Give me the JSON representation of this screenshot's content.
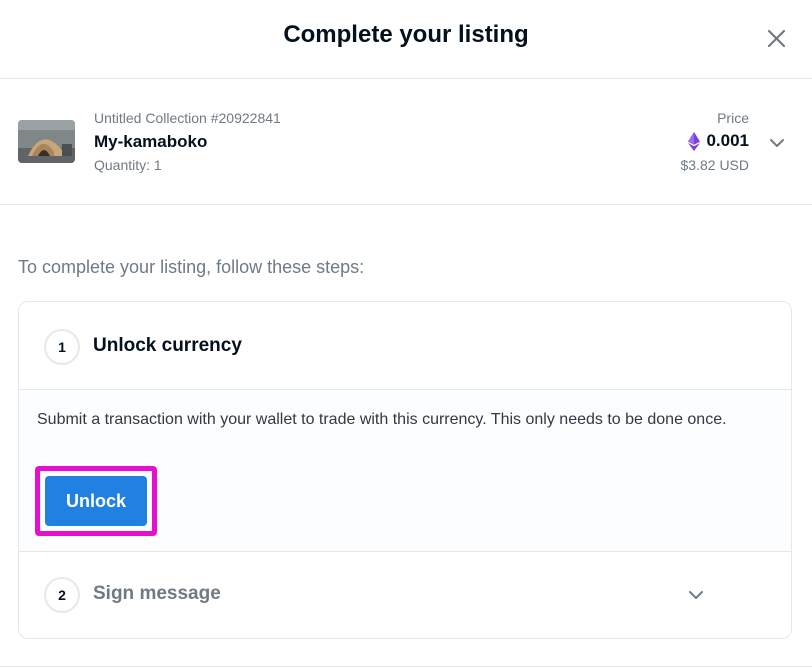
{
  "dialog": {
    "title": "Complete your listing"
  },
  "item": {
    "collection": "Untitled Collection #20922841",
    "name": "My-kamaboko",
    "quantity": "Quantity: 1",
    "price_label": "Price",
    "price": "0.001",
    "price_usd": "$3.82 USD",
    "currency_icon": "ethereum-icon"
  },
  "intro": "To complete your listing, follow these steps:",
  "steps": [
    {
      "number": "1",
      "title": "Unlock currency",
      "description": "Submit a transaction with your wallet to trade with this currency. This only needs to be done once.",
      "button": "Unlock"
    },
    {
      "number": "2",
      "title": "Sign message"
    }
  ],
  "colors": {
    "accent": "#2081e2",
    "highlight": "#e60fd0",
    "ethereum": "#7b3fe4",
    "text": "#04111d",
    "muted": "#707a83",
    "border": "#e5e8eb"
  }
}
